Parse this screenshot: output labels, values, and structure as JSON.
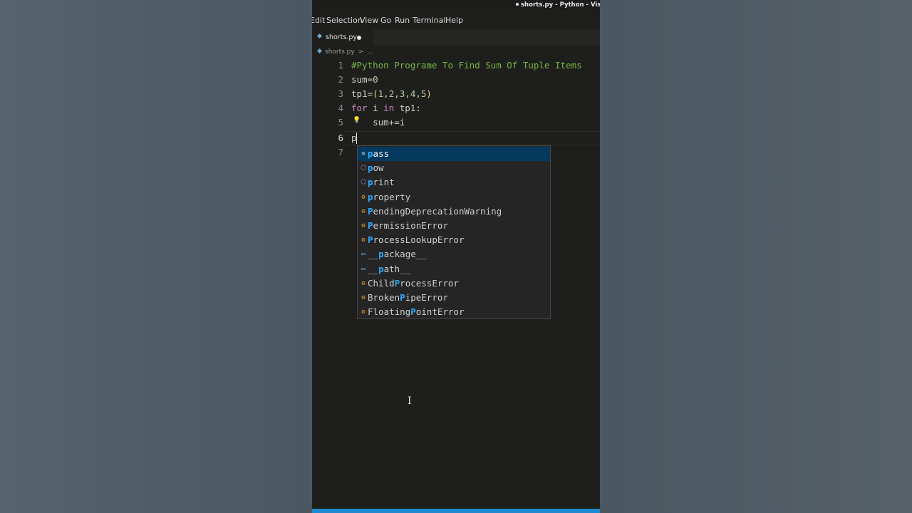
{
  "window": {
    "title": "shorts.py - Python - Visual Stud"
  },
  "menu": {
    "items": [
      "Edit",
      "Selection",
      "View",
      "Go",
      "Run",
      "Terminal",
      "Help"
    ]
  },
  "tab": {
    "label": "shorts.py",
    "icon": "python-file-icon"
  },
  "breadcrumb": {
    "file": "shorts.py",
    "separator": ">",
    "rest": "..."
  },
  "editor": {
    "line_numbers": [
      "1",
      "2",
      "3",
      "4",
      "5",
      "6",
      "7"
    ],
    "lines": {
      "l1": "#Python Programe To Find Sum Of Tuple Items",
      "l2_a": "sum",
      "l2_b": "=",
      "l2_c": "0",
      "l3_a": "tp1",
      "l3_b": "=",
      "l3_c": "(",
      "l3_d": "1",
      "l3_e": ",",
      "l3_f": "2",
      "l3_g": ",",
      "l3_h": "3",
      "l3_i": ",",
      "l3_j": "4",
      "l3_k": ",",
      "l3_l": "5",
      "l3_m": ")",
      "l4_a": "for",
      "l4_b": " i ",
      "l4_c": "in",
      "l4_d": " tp1:",
      "l5": "    sum+=i",
      "l6": "p"
    }
  },
  "suggestions": {
    "items": [
      {
        "icon": "keyword-icon",
        "match": "p",
        "rest": "ass",
        "selected": true
      },
      {
        "icon": "function-icon",
        "match": "p",
        "rest": "ow"
      },
      {
        "icon": "function-icon",
        "match": "p",
        "rest": "rint"
      },
      {
        "icon": "class-icon",
        "match": "p",
        "rest": "roperty"
      },
      {
        "icon": "class-icon",
        "match": "P",
        "rest": "endingDeprecationWarning"
      },
      {
        "icon": "class-icon",
        "match": "P",
        "rest": "ermissionError"
      },
      {
        "icon": "class-icon",
        "match": "P",
        "rest": "rocessLookupError"
      },
      {
        "icon": "variable-icon",
        "pre": "__",
        "match": "p",
        "rest": "ackage__"
      },
      {
        "icon": "variable-icon",
        "pre": "__",
        "match": "p",
        "rest": "ath__"
      },
      {
        "icon": "class-icon",
        "pre": "Child",
        "match": "P",
        "rest": "rocessError"
      },
      {
        "icon": "class-icon",
        "pre": "Broken",
        "match": "P",
        "rest": "ipeError"
      },
      {
        "icon": "class-icon",
        "pre": "Floating",
        "match": "P",
        "rest": "ointError"
      }
    ]
  },
  "colors": {
    "accent": "#1f8ad2",
    "selection": "#04395e",
    "match_highlight": "#2aaaff",
    "comment": "#75b347",
    "keyword": "#c586c0"
  }
}
